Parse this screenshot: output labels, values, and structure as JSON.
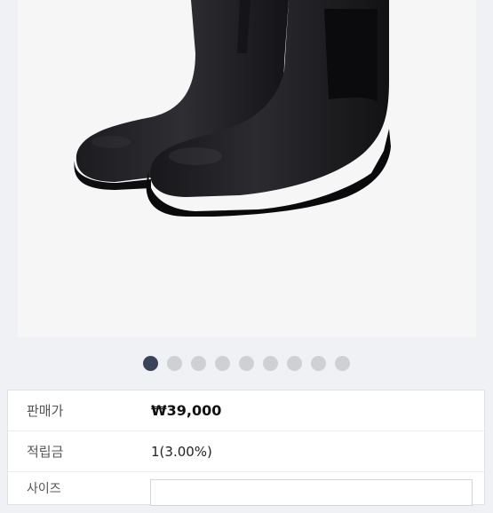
{
  "product": {
    "image_icon": "black-rain-boots-image",
    "carousel": {
      "total": 9,
      "active_index": 0
    }
  },
  "info": {
    "price": {
      "label": "판매가",
      "value": "₩39,000"
    },
    "points": {
      "label": "적립금",
      "value": "1(3.00%)"
    },
    "option": {
      "label": "사이즈"
    }
  },
  "colors": {
    "dot_active": "#3a4458",
    "dot_inactive": "#cfd0d3"
  }
}
